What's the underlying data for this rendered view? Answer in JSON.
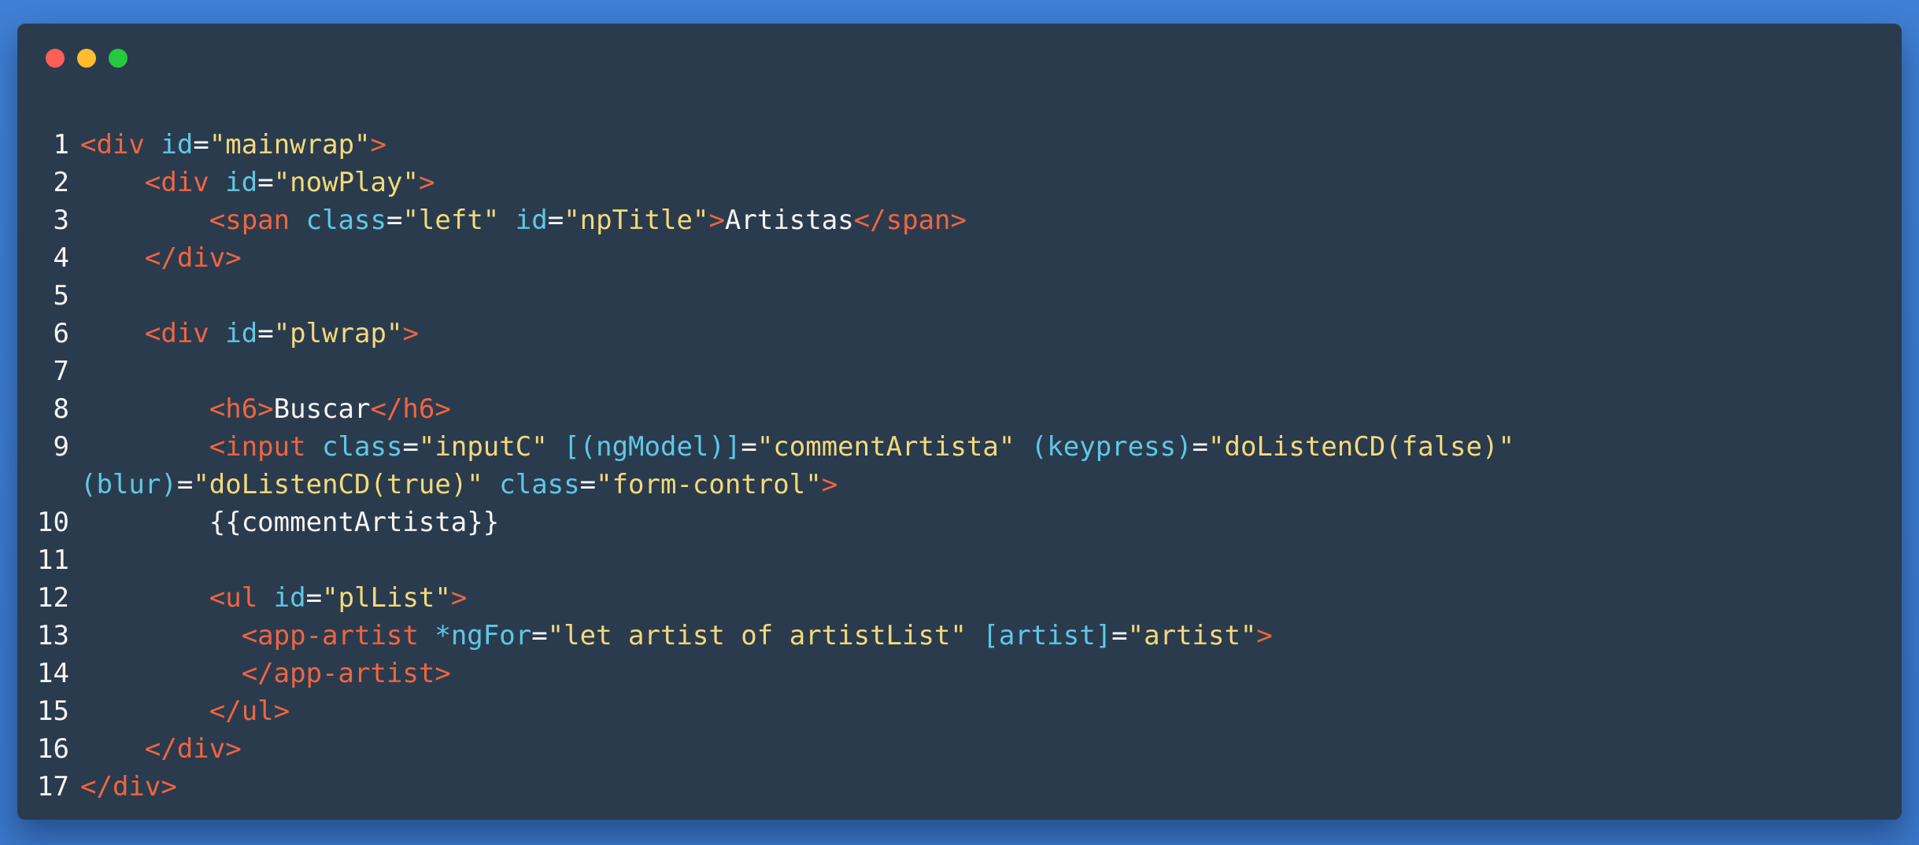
{
  "window": {
    "controls": [
      {
        "name": "close",
        "color": "#ff5f56"
      },
      {
        "name": "minimize",
        "color": "#ffbd2e"
      },
      {
        "name": "maximize",
        "color": "#27c93f"
      }
    ]
  },
  "theme": {
    "background": "#2b3b4e",
    "tag": "#f0653f",
    "attribute": "#5ec8e5",
    "string": "#f2da7a",
    "text": "#f4f5f7"
  },
  "code": {
    "lines": [
      {
        "n": "1",
        "tokens": [
          {
            "t": "tag",
            "v": "<div"
          },
          {
            "t": "text",
            "v": " "
          },
          {
            "t": "attr",
            "v": "id"
          },
          {
            "t": "punct",
            "v": "="
          },
          {
            "t": "str",
            "v": "\"mainwrap\""
          },
          {
            "t": "tag",
            "v": ">"
          }
        ]
      },
      {
        "n": "2",
        "tokens": [
          {
            "t": "text",
            "v": "    "
          },
          {
            "t": "tag",
            "v": "<div"
          },
          {
            "t": "text",
            "v": " "
          },
          {
            "t": "attr",
            "v": "id"
          },
          {
            "t": "punct",
            "v": "="
          },
          {
            "t": "str",
            "v": "\"nowPlay\""
          },
          {
            "t": "tag",
            "v": ">"
          }
        ]
      },
      {
        "n": "3",
        "tokens": [
          {
            "t": "text",
            "v": "        "
          },
          {
            "t": "tag",
            "v": "<span"
          },
          {
            "t": "text",
            "v": " "
          },
          {
            "t": "attr",
            "v": "class"
          },
          {
            "t": "punct",
            "v": "="
          },
          {
            "t": "str",
            "v": "\"left\""
          },
          {
            "t": "text",
            "v": " "
          },
          {
            "t": "attr",
            "v": "id"
          },
          {
            "t": "punct",
            "v": "="
          },
          {
            "t": "str",
            "v": "\"npTitle\""
          },
          {
            "t": "tag",
            "v": ">"
          },
          {
            "t": "text",
            "v": "Artistas"
          },
          {
            "t": "tag",
            "v": "</span>"
          }
        ]
      },
      {
        "n": "4",
        "tokens": [
          {
            "t": "text",
            "v": "    "
          },
          {
            "t": "tag",
            "v": "</div>"
          }
        ]
      },
      {
        "n": "5",
        "tokens": []
      },
      {
        "n": "6",
        "tokens": [
          {
            "t": "text",
            "v": "    "
          },
          {
            "t": "tag",
            "v": "<div"
          },
          {
            "t": "text",
            "v": " "
          },
          {
            "t": "attr",
            "v": "id"
          },
          {
            "t": "punct",
            "v": "="
          },
          {
            "t": "str",
            "v": "\"plwrap\""
          },
          {
            "t": "tag",
            "v": ">"
          }
        ]
      },
      {
        "n": "7",
        "tokens": []
      },
      {
        "n": "8",
        "tokens": [
          {
            "t": "text",
            "v": "        "
          },
          {
            "t": "tag",
            "v": "<h6>"
          },
          {
            "t": "text",
            "v": "Buscar"
          },
          {
            "t": "tag",
            "v": "</h6>"
          }
        ]
      },
      {
        "n": "9",
        "wrap": true,
        "tokens": [
          {
            "t": "text",
            "v": "        "
          },
          {
            "t": "tag",
            "v": "<input"
          },
          {
            "t": "text",
            "v": " "
          },
          {
            "t": "attr",
            "v": "class"
          },
          {
            "t": "punct",
            "v": "="
          },
          {
            "t": "str",
            "v": "\"inputC\""
          },
          {
            "t": "text",
            "v": " "
          },
          {
            "t": "attr",
            "v": "[(ngModel)]"
          },
          {
            "t": "punct",
            "v": "="
          },
          {
            "t": "str",
            "v": "\"commentArtista\""
          },
          {
            "t": "text",
            "v": " "
          },
          {
            "t": "attr",
            "v": "(keypress)"
          },
          {
            "t": "punct",
            "v": "="
          },
          {
            "t": "str",
            "v": "\"doListenCD(false)\""
          },
          {
            "t": "text",
            "v": "\n"
          },
          {
            "t": "attr",
            "v": "(blur)"
          },
          {
            "t": "punct",
            "v": "="
          },
          {
            "t": "str",
            "v": "\"doListenCD(true)\""
          },
          {
            "t": "text",
            "v": " "
          },
          {
            "t": "attr",
            "v": "class"
          },
          {
            "t": "punct",
            "v": "="
          },
          {
            "t": "str",
            "v": "\"form-control\""
          },
          {
            "t": "tag",
            "v": ">"
          }
        ]
      },
      {
        "n": "10",
        "tokens": [
          {
            "t": "text",
            "v": "        {{commentArtista}}"
          }
        ]
      },
      {
        "n": "11",
        "tokens": []
      },
      {
        "n": "12",
        "tokens": [
          {
            "t": "text",
            "v": "        "
          },
          {
            "t": "tag",
            "v": "<ul"
          },
          {
            "t": "text",
            "v": " "
          },
          {
            "t": "attr",
            "v": "id"
          },
          {
            "t": "punct",
            "v": "="
          },
          {
            "t": "str",
            "v": "\"plList\""
          },
          {
            "t": "tag",
            "v": ">"
          }
        ]
      },
      {
        "n": "13",
        "tokens": [
          {
            "t": "text",
            "v": "          "
          },
          {
            "t": "tag",
            "v": "<app-artist"
          },
          {
            "t": "text",
            "v": " "
          },
          {
            "t": "attr",
            "v": "*ngFor"
          },
          {
            "t": "punct",
            "v": "="
          },
          {
            "t": "str",
            "v": "\"let artist of artistList\""
          },
          {
            "t": "text",
            "v": " "
          },
          {
            "t": "attr",
            "v": "[artist]"
          },
          {
            "t": "punct",
            "v": "="
          },
          {
            "t": "str",
            "v": "\"artist\""
          },
          {
            "t": "tag",
            "v": ">"
          }
        ]
      },
      {
        "n": "14",
        "tokens": [
          {
            "t": "text",
            "v": "          "
          },
          {
            "t": "tag",
            "v": "</app-artist>"
          }
        ]
      },
      {
        "n": "15",
        "tokens": [
          {
            "t": "text",
            "v": "        "
          },
          {
            "t": "tag",
            "v": "</ul>"
          }
        ]
      },
      {
        "n": "16",
        "tokens": [
          {
            "t": "text",
            "v": "    "
          },
          {
            "t": "tag",
            "v": "</div>"
          }
        ]
      },
      {
        "n": "17",
        "tokens": [
          {
            "t": "tag",
            "v": "</div>"
          }
        ]
      }
    ]
  }
}
